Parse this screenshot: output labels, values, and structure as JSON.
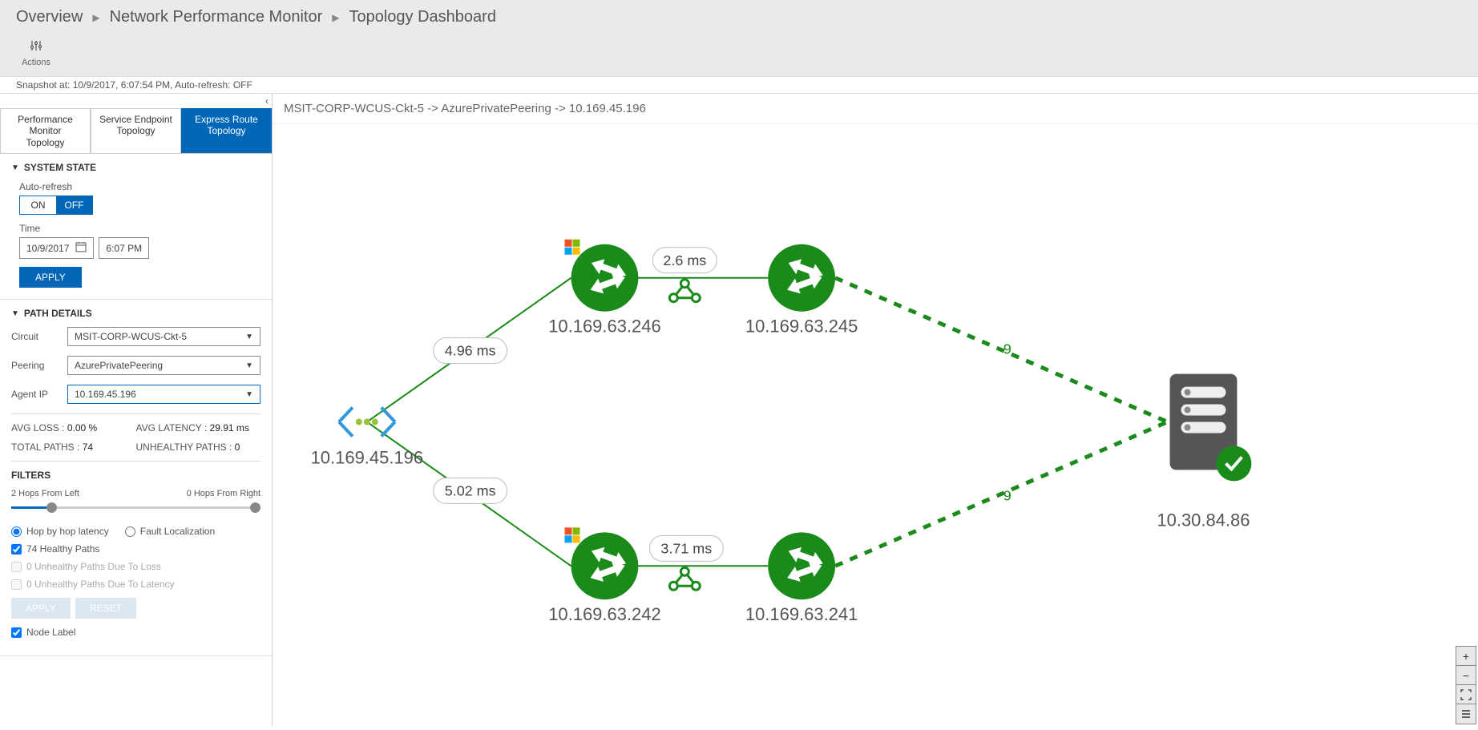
{
  "breadcrumb": [
    "Overview",
    "Network Performance Monitor",
    "Topology Dashboard"
  ],
  "actions_label": "Actions",
  "snapshot": "Snapshot at: 10/9/2017, 6:07:54 PM, Auto-refresh: OFF",
  "tabs": [
    {
      "line1": "Performance Monitor",
      "line2": "Topology"
    },
    {
      "line1": "Service Endpoint",
      "line2": "Topology"
    },
    {
      "line1": "Express Route",
      "line2": "Topology"
    }
  ],
  "system_state": {
    "title": "SYSTEM STATE",
    "auto_refresh_label": "Auto-refresh",
    "on": "ON",
    "off": "OFF",
    "time_label": "Time",
    "date": "10/9/2017",
    "time": "6:07 PM",
    "apply": "APPLY"
  },
  "path_details": {
    "title": "PATH DETAILS",
    "circuit_label": "Circuit",
    "circuit_value": "MSIT-CORP-WCUS-Ckt-5",
    "peering_label": "Peering",
    "peering_value": "AzurePrivatePeering",
    "agentip_label": "Agent IP",
    "agentip_value": "10.169.45.196",
    "avg_loss_label": "AVG LOSS :",
    "avg_loss_value": "0.00 %",
    "avg_latency_label": "AVG LATENCY :",
    "avg_latency_value": "29.91 ms",
    "total_paths_label": "TOTAL PATHS :",
    "total_paths_value": "74",
    "unhealthy_paths_label": "UNHEALTHY PATHS :",
    "unhealthy_paths_value": "0"
  },
  "filters": {
    "title": "FILTERS",
    "left_label": "2 Hops From Left",
    "right_label": "0 Hops From Right",
    "radio1": "Hop by hop latency",
    "radio2": "Fault Localization",
    "check1": "74 Healthy Paths",
    "check2": "0 Unhealthy Paths Due To Loss",
    "check3": "0 Unhealthy Paths Due To Latency",
    "apply": "APPLY",
    "reset": "RESET",
    "node_label": "Node Label"
  },
  "canvas_title": "MSIT-CORP-WCUS-Ckt-5 -> AzurePrivatePeering -> 10.169.45.196",
  "topology": {
    "source": {
      "ip": "10.169.45.196"
    },
    "top": {
      "hop1_ip": "10.169.63.246",
      "hop1_latency": "4.96 ms",
      "hop2_ip": "10.169.63.245",
      "hop2_latency": "2.6 ms",
      "dashed_hops": "9"
    },
    "bottom": {
      "hop1_ip": "10.169.63.242",
      "hop1_latency": "5.02 ms",
      "hop2_ip": "10.169.63.241",
      "hop2_latency": "3.71 ms",
      "dashed_hops": "9"
    },
    "dest": {
      "ip": "10.30.84.86"
    }
  }
}
